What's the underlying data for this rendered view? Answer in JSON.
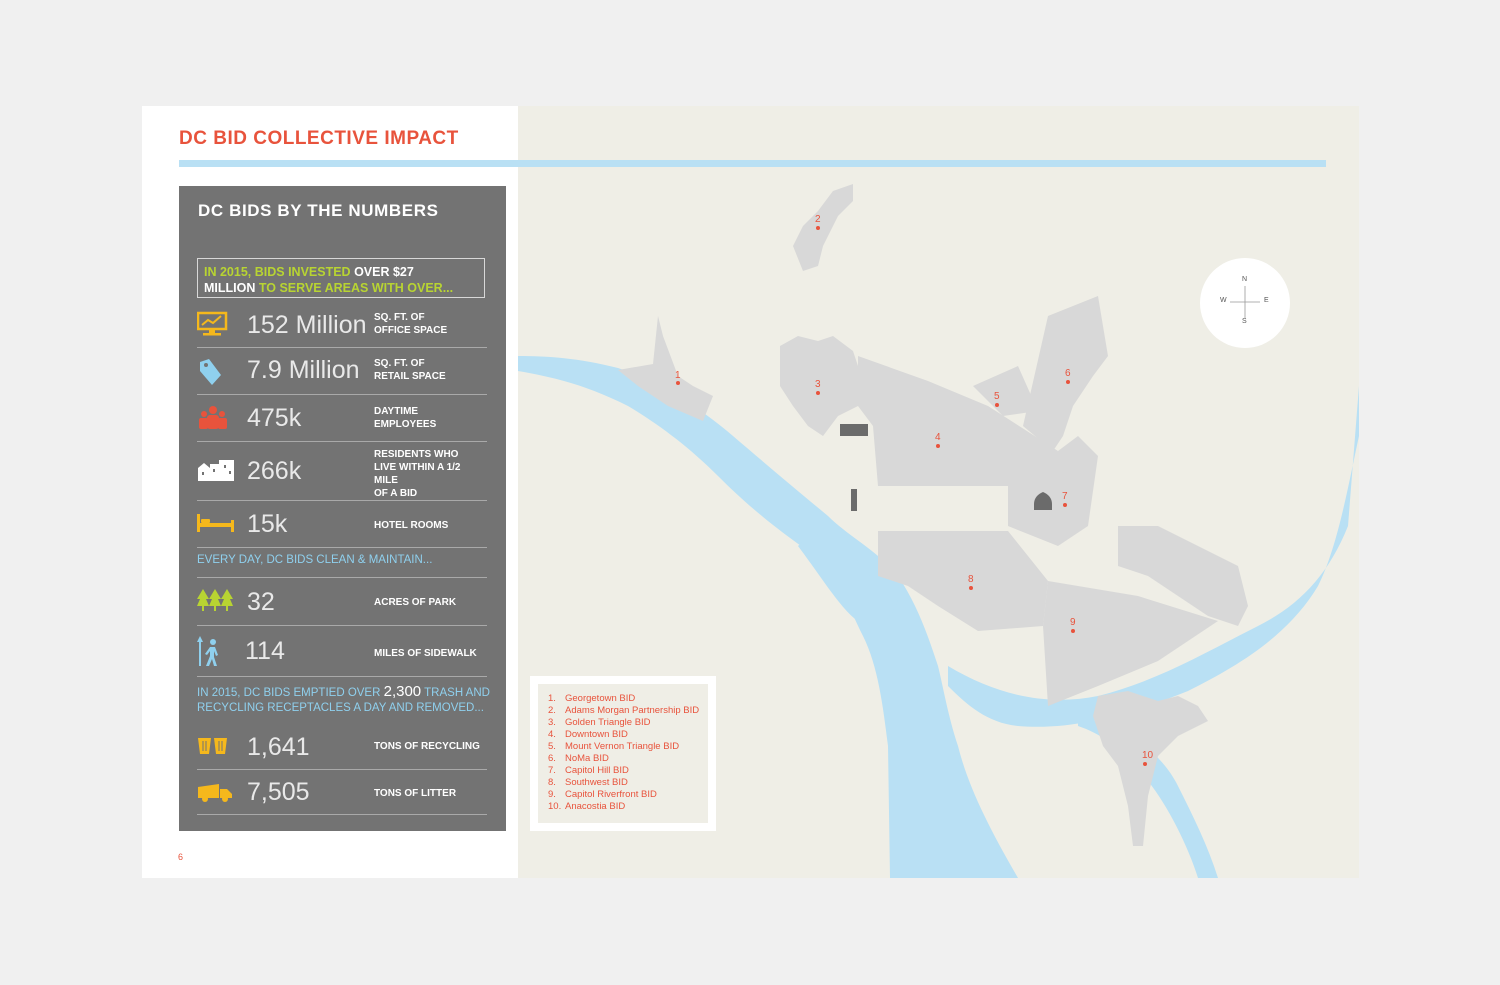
{
  "header": {
    "title": "DC BID COLLECTIVE IMPACT"
  },
  "panel": {
    "title": "DC BIDS BY THE NUMBERS",
    "callout": {
      "part1": "IN 2015, BIDS INVESTED ",
      "part2": "OVER $27",
      "part3": "MILLION",
      "part4": " TO SERVE AREAS WITH OVER..."
    },
    "stats": [
      {
        "value": "152 Million",
        "label_line1": "SQ. FT. OF",
        "label_line2": "OFFICE SPACE",
        "icon": "office-chart-icon"
      },
      {
        "value": "7.9 Million",
        "label_line1": "SQ. FT. OF",
        "label_line2": "RETAIL SPACE",
        "icon": "price-tag-icon"
      },
      {
        "value": "475k",
        "label_line1": "DAYTIME",
        "label_line2": "EMPLOYEES",
        "icon": "employees-icon"
      },
      {
        "value": "266k",
        "label_line1": "RESIDENTS WHO",
        "label_line2": "LIVE WITHIN A 1/2 MILE",
        "label_line3": "OF A BID",
        "icon": "residences-icon"
      },
      {
        "value": "15k",
        "label_line1": "HOTEL ROOMS",
        "icon": "bed-icon"
      }
    ],
    "maintain_intro": "EVERY DAY, DC BIDS CLEAN & MAINTAIN...",
    "maintain": [
      {
        "value": "32",
        "label": "ACRES OF PARK",
        "icon": "trees-icon"
      },
      {
        "value": "114",
        "label": "MILES OF SIDEWALK",
        "icon": "pedestrian-icon"
      }
    ],
    "trash_intro": {
      "part1": "IN 2015, DC BIDS EMPTIED OVER ",
      "part2": "2,300",
      "part3": " TRASH AND",
      "line2": "RECYCLING RECEPTACLES A DAY AND REMOVED..."
    },
    "trash": [
      {
        "value": "1,641",
        "label": "TONS OF RECYCLING",
        "icon": "recycling-bins-icon"
      },
      {
        "value": "7,505",
        "label": "TONS OF LITTER",
        "icon": "garbage-truck-icon"
      }
    ]
  },
  "page_number": "6",
  "map": {
    "markers": [
      "1",
      "2",
      "3",
      "4",
      "5",
      "6",
      "7",
      "8",
      "9",
      "10"
    ],
    "compass": {
      "n": "N",
      "s": "S",
      "e": "E",
      "w": "W"
    },
    "legend": [
      {
        "n": "1.",
        "name": "Georgetown BID"
      },
      {
        "n": "2.",
        "name": "Adams Morgan Partnership BID"
      },
      {
        "n": "3.",
        "name": "Golden Triangle BID"
      },
      {
        "n": "4.",
        "name": "Downtown BID"
      },
      {
        "n": "5.",
        "name": "Mount Vernon Triangle BID"
      },
      {
        "n": "6.",
        "name": "NoMa BID"
      },
      {
        "n": "7.",
        "name": "Capitol Hill BID"
      },
      {
        "n": "8.",
        "name": "Southwest BID"
      },
      {
        "n": "9.",
        "name": "Capitol Riverfront BID"
      },
      {
        "n": "10.",
        "name": "Anacostia BID"
      }
    ],
    "colors": {
      "water": "#b9e0f4",
      "district": "#d8d8d8",
      "land": "#efeee6",
      "accent": "#e8533c"
    }
  }
}
